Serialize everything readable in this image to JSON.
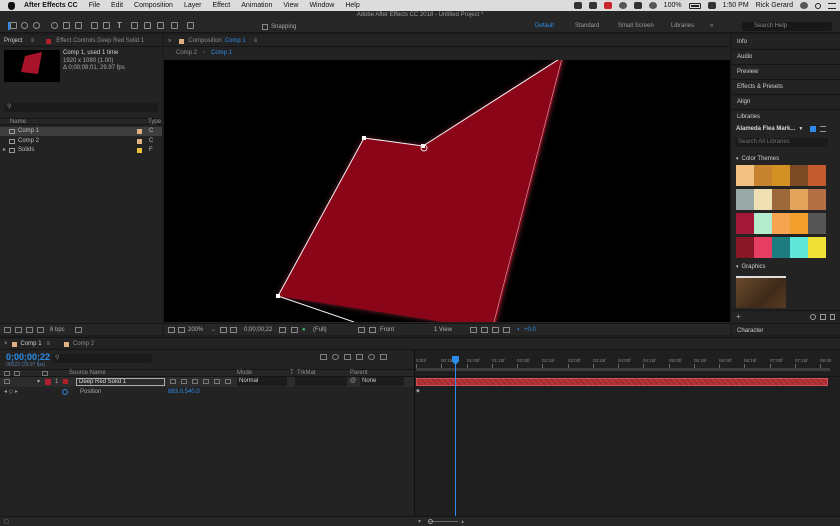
{
  "menubar": {
    "app": "After Effects CC",
    "items": [
      "File",
      "Edit",
      "Composition",
      "Layer",
      "Effect",
      "Animation",
      "View",
      "Window",
      "Help"
    ],
    "battery": "100%",
    "clock": "1:50 PM",
    "user": "Rick Gerard"
  },
  "window": {
    "title": "Adobe After Effects CC 2018 - Untitled Project *"
  },
  "toolbar": {
    "snapping_label": "Snapping",
    "workspaces": [
      "Default",
      "Standard",
      "Small Screen",
      "Libraries"
    ],
    "active_workspace": "Default",
    "search_placeholder": "Search Help"
  },
  "project": {
    "tab": "Project",
    "effect_controls_tab": "Effect Controls Deep Red Solid 1",
    "selected_name": "Comp 1",
    "used": ", used 1 time",
    "dims": "1920 x 1080 (1.00)",
    "duration": "Δ 0;00;08;01, 29.97 fps",
    "col_name": "Name",
    "col_type": "Type",
    "items": [
      {
        "name": "Comp 1",
        "type": "C",
        "color": "#e0b084",
        "selected": true
      },
      {
        "name": "Comp 2",
        "type": "C",
        "color": "#e0b084",
        "selected": false
      },
      {
        "name": "Solids",
        "type": "F",
        "color": "#e8c33a",
        "selected": false
      }
    ],
    "bpc": "8 bpc"
  },
  "comp": {
    "tab_prefix": "Composition",
    "tab_name": "Comp 1",
    "breadcrumbs": [
      "Comp 2",
      "Comp 1"
    ],
    "zoom": "200%",
    "timecode": "0;00;00;22",
    "resolution": "(Full)",
    "view": "Front",
    "views": "1 View",
    "exposure": "+0.0"
  },
  "right_panel": {
    "sections": [
      "Info",
      "Audio",
      "Preview",
      "Effects & Presets",
      "Align"
    ],
    "libraries_title": "Libraries",
    "library_name": "Alameda Flea Mark...",
    "library_search_placeholder": "Search All Libraries",
    "color_themes_label": "Color Themes",
    "color_themes": [
      [
        "#f3c282",
        "#c7842e",
        "#d39023",
        "#7b4a24",
        "#c25a2e"
      ],
      [
        "#9aa9a6",
        "#efe0b4",
        "#9c6839",
        "#e2a35a",
        "#b27044"
      ],
      [
        "#a51739",
        "#b5ebce",
        "#f6a44f",
        "#f29f2c",
        "#555555"
      ],
      [
        "#8a1726",
        "#e63d63",
        "#1c7c80",
        "#5fe6d6",
        "#f0e036"
      ]
    ],
    "graphics_label": "Graphics",
    "character_label": "Character"
  },
  "timeline": {
    "tabs": [
      "Comp 1",
      "Comp 2"
    ],
    "timecode": "0;00;00;22",
    "timecode_sub": "00022 (29.97 fps)",
    "col_source_name": "Source Name",
    "col_mode": "Mode",
    "col_trkmat": "TrkMat",
    "col_parent": "Parent",
    "layer": {
      "index": "1",
      "name": "Deep Red Solid 1",
      "mode": "Normal",
      "parent": "None"
    },
    "property": {
      "name": "Position",
      "value": "883.0,540.0"
    },
    "ruler": [
      "0:00f",
      "00:15f",
      "01:00f",
      "01:15f",
      "02:00f",
      "02:15f",
      "03:00f",
      "03:15f",
      "04:00f",
      "04:15f",
      "05:00f",
      "05:15f",
      "06:00f",
      "06:15f",
      "07:00f",
      "07:15f",
      "08:00"
    ]
  }
}
